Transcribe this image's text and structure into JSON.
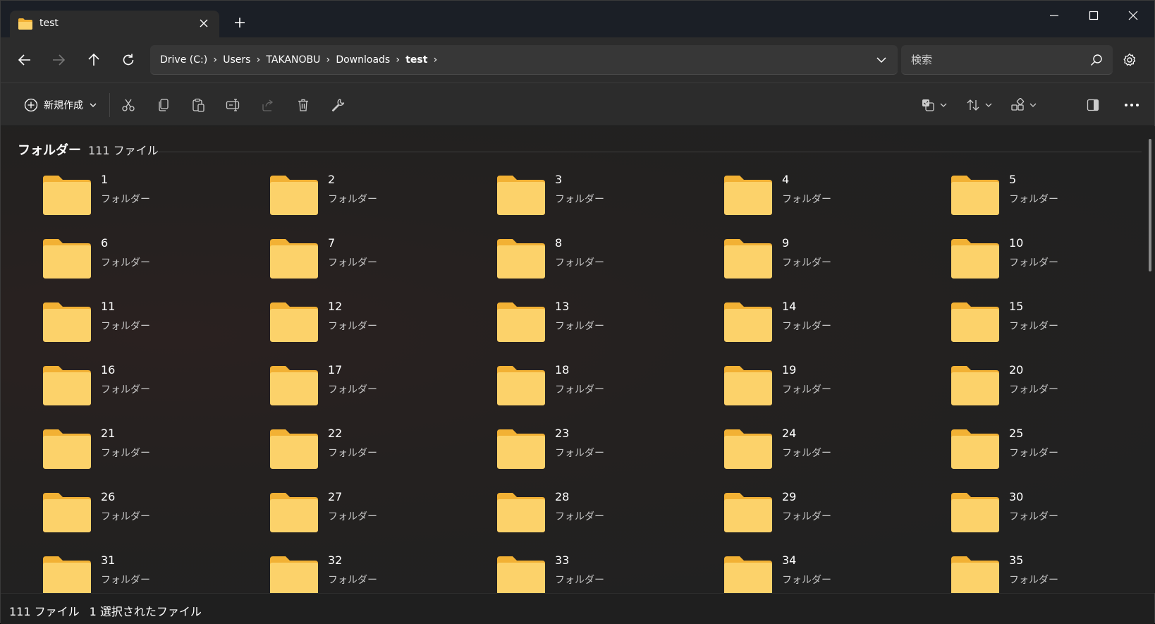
{
  "tab": {
    "title": "test"
  },
  "address": {
    "crumbs": [
      "Drive (C:)",
      "Users",
      "TAKANOBU",
      "Downloads",
      "test"
    ]
  },
  "search": {
    "placeholder": "検索"
  },
  "commands": {
    "new_label": "新規作成"
  },
  "group": {
    "title": "フォルダー",
    "count": "111 ファイル"
  },
  "folders": [
    {
      "name": "1",
      "type": "フォルダー"
    },
    {
      "name": "2",
      "type": "フォルダー"
    },
    {
      "name": "3",
      "type": "フォルダー"
    },
    {
      "name": "4",
      "type": "フォルダー"
    },
    {
      "name": "5",
      "type": "フォルダー"
    },
    {
      "name": "6",
      "type": "フォルダー"
    },
    {
      "name": "7",
      "type": "フォルダー"
    },
    {
      "name": "8",
      "type": "フォルダー"
    },
    {
      "name": "9",
      "type": "フォルダー"
    },
    {
      "name": "10",
      "type": "フォルダー"
    },
    {
      "name": "11",
      "type": "フォルダー"
    },
    {
      "name": "12",
      "type": "フォルダー"
    },
    {
      "name": "13",
      "type": "フォルダー"
    },
    {
      "name": "14",
      "type": "フォルダー"
    },
    {
      "name": "15",
      "type": "フォルダー"
    },
    {
      "name": "16",
      "type": "フォルダー"
    },
    {
      "name": "17",
      "type": "フォルダー"
    },
    {
      "name": "18",
      "type": "フォルダー"
    },
    {
      "name": "19",
      "type": "フォルダー"
    },
    {
      "name": "20",
      "type": "フォルダー"
    },
    {
      "name": "21",
      "type": "フォルダー"
    },
    {
      "name": "22",
      "type": "フォルダー"
    },
    {
      "name": "23",
      "type": "フォルダー"
    },
    {
      "name": "24",
      "type": "フォルダー"
    },
    {
      "name": "25",
      "type": "フォルダー"
    },
    {
      "name": "26",
      "type": "フォルダー"
    },
    {
      "name": "27",
      "type": "フォルダー"
    },
    {
      "name": "28",
      "type": "フォルダー"
    },
    {
      "name": "29",
      "type": "フォルダー"
    },
    {
      "name": "30",
      "type": "フォルダー"
    },
    {
      "name": "31",
      "type": "フォルダー"
    },
    {
      "name": "32",
      "type": "フォルダー"
    },
    {
      "name": "33",
      "type": "フォルダー"
    },
    {
      "name": "34",
      "type": "フォルダー"
    },
    {
      "name": "35",
      "type": "フォルダー"
    }
  ],
  "status": {
    "count": "111 ファイル",
    "selected": "1 選択されたファイル"
  },
  "colors": {
    "folder_back": "#f2b134",
    "folder_front": "#fcd26a",
    "background": "#202020"
  }
}
